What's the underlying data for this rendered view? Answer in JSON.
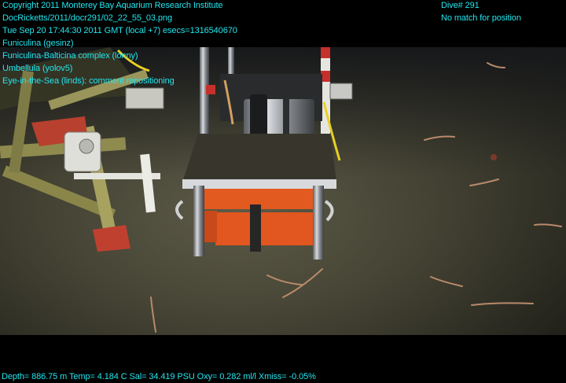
{
  "overlay": {
    "left_lines": [
      "Copyright 2011 Monterey Bay Aquarium Research Institute",
      "DocRicketts/2011/docr291/02_22_55_03.png",
      "Tue Sep 20 17:44:30 2011 GMT (local +7)  esecs=1316540670",
      "Funiculina (gesinz)",
      "Funiculina-Balticina complex (lonny)",
      "Umbellula (yolov5)",
      "Eye-in-the-Sea (linds): comment repositioning"
    ],
    "right_lines": [
      "Dive# 291",
      "No match for position"
    ],
    "bottom_line": "Depth= 886.75 m  Temp= 4.184 C  Sal= 34.419 PSU  Oxy= 0.282 ml/l  Xmiss= -0.05%"
  },
  "colors": {
    "overlay_text": "#22e6ee",
    "background": "#000000",
    "seafloor": "#4a4836",
    "instrument_orange": "#e2561f"
  }
}
